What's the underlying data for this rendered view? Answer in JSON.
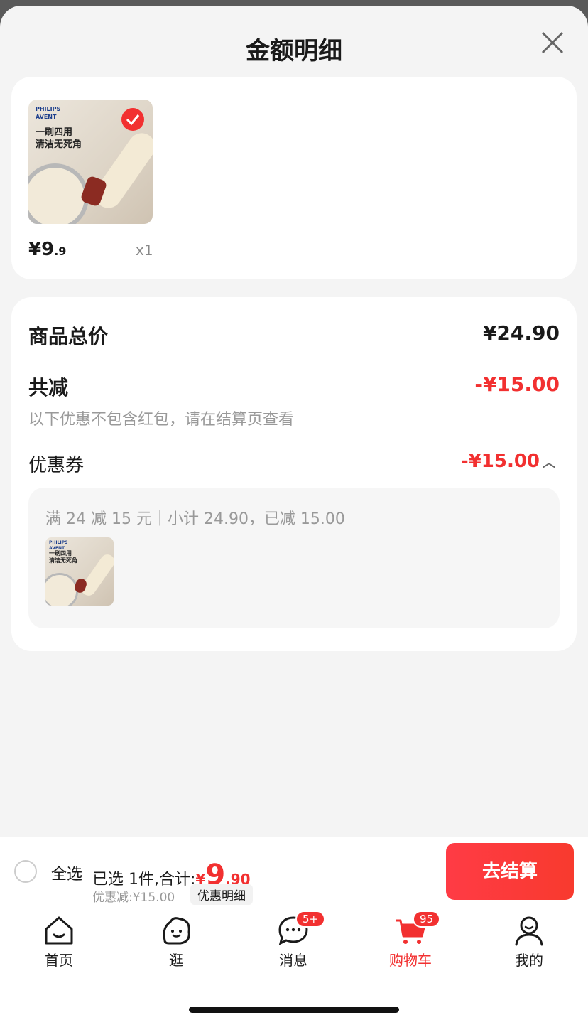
{
  "sheet": {
    "title": "金额明细"
  },
  "product": {
    "brand_line1": "PHILIPS",
    "brand_line2": "AVENT",
    "image_text_line1": "一刷四用",
    "image_text_line2": "清洁无死角",
    "price_int": "¥9",
    "price_dec": ".9",
    "quantity": "x1"
  },
  "summary": {
    "total_label": "商品总价",
    "total_value": "¥24.90",
    "reduction_label": "共减",
    "reduction_value": "-¥15.00",
    "reduction_note": "以下优惠不包含红包，请在结算页查看",
    "coupon_label": "优惠券",
    "coupon_value": "-¥15.00",
    "coupon_rule": "满 24 减 15 元｜小计 24.90，已减 15.00"
  },
  "footer": {
    "select_all": "全选",
    "selected_text": "已选 1件,合计:",
    "total_yen": "¥",
    "total_int": "9",
    "total_dec": ".90",
    "discount_text": "优惠减:¥15.00",
    "detail_chip": "优惠明细",
    "checkout": "去结算"
  },
  "tabs": [
    {
      "label": "首页",
      "icon": "home-icon"
    },
    {
      "label": "逛",
      "icon": "browse-icon"
    },
    {
      "label": "消息",
      "icon": "message-icon",
      "badge": "5+"
    },
    {
      "label": "购物车",
      "icon": "cart-icon",
      "badge": "95",
      "active": true
    },
    {
      "label": "我的",
      "icon": "profile-icon"
    }
  ],
  "colors": {
    "accent": "#f23030",
    "background": "#f4f4f4"
  }
}
